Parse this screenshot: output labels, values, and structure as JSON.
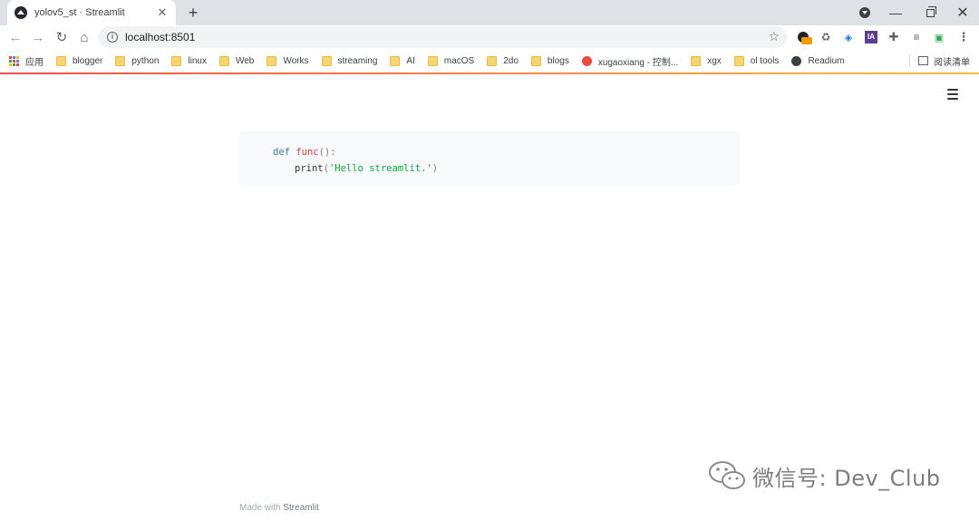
{
  "tab": {
    "title": "yolov5_st · Streamlit",
    "close": "✕"
  },
  "window": {
    "new_tab": "+",
    "minimize": "—",
    "close": "✕"
  },
  "toolbar": {
    "back": "←",
    "forward": "→",
    "reload": "↻",
    "home": "⌂",
    "url": "localhost:8501",
    "star": "☆",
    "extensions": [
      "profile-icon",
      "recycle-icon",
      "stack-icon",
      "ia-icon",
      "puzzle-icon",
      "playlist-icon",
      "cast-icon",
      "more-icon"
    ],
    "ia_label": "IA"
  },
  "bookmarks": {
    "apps": "应用",
    "items": [
      "blogger",
      "python",
      "linux",
      "Web",
      "Works",
      "streaming",
      "AI",
      "macOS",
      "2do",
      "blogs",
      "xugaoxiang - 控制...",
      "xgx",
      "ol tools",
      "Readium"
    ],
    "reading_list": "阅读清单"
  },
  "code": {
    "line1": {
      "keyword": "def",
      "name": "func",
      "punct": "():"
    },
    "line2": {
      "call": "print",
      "open": "(",
      "string": "'Hello streamlit.'",
      "close": ")"
    }
  },
  "footer": {
    "prefix": "Made with",
    "link": "Streamlit"
  },
  "watermark": {
    "text": "微信号: Dev_Club"
  },
  "colors": {
    "accent_start": "#ff4b4b",
    "accent_end": "#ffbd45",
    "code_background": "#f8f9fb"
  }
}
